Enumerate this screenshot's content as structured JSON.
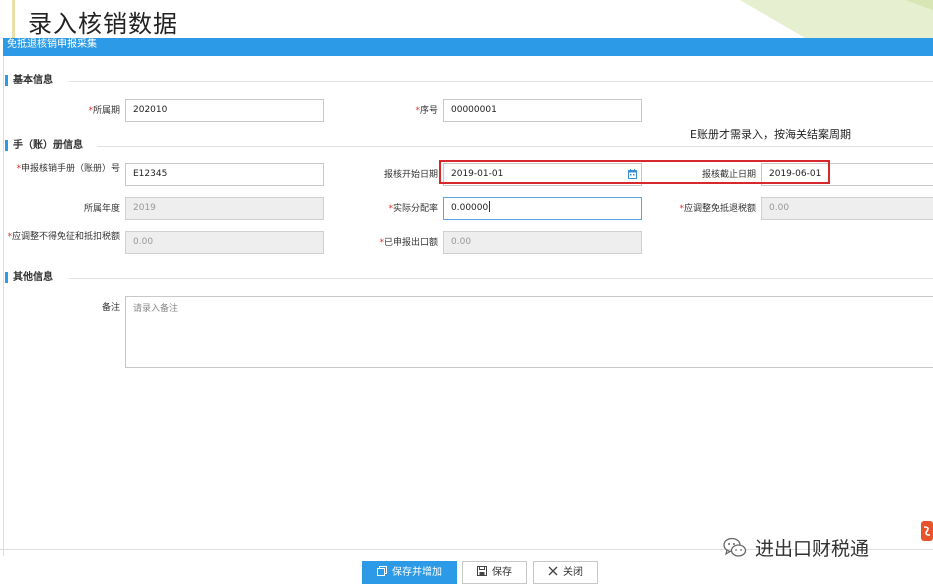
{
  "slide": {
    "title": "录入核销数据"
  },
  "header": {
    "title": "免抵退核销申报采集"
  },
  "sections": {
    "basic": "基本信息",
    "manual": "手（账）册信息",
    "other": "其他信息"
  },
  "fields": {
    "period": {
      "label": "所属期",
      "value": "202010"
    },
    "serial": {
      "label": "序号",
      "value": "00000001"
    },
    "manual_no": {
      "label": "申报核销手册（账册）号",
      "value": "E12345"
    },
    "start_date": {
      "label": "报核开始日期",
      "value": "2019-01-01"
    },
    "end_date": {
      "label": "报核截止日期",
      "value": "2019-06-01"
    },
    "year": {
      "label": "所属年度",
      "value": "2019"
    },
    "ratio": {
      "label": "实际分配率",
      "value": "0.00000"
    },
    "adj_refund": {
      "label": "应调整免抵退税额",
      "value": "0.00"
    },
    "adj_nodeduct": {
      "label": "应调整不得免征和抵扣税额",
      "value": "0.00"
    },
    "exported": {
      "label": "已申报出口额",
      "value": "0.00"
    },
    "remark": {
      "label": "备注",
      "placeholder": "请录入备注"
    }
  },
  "annotation": {
    "note": "E账册才需录入，按海关结案周期"
  },
  "buttons": {
    "save_add": "保存并增加",
    "save": "保存",
    "close": "关闭"
  },
  "watermark": {
    "text": "进出口财税通"
  },
  "colors": {
    "accent": "#2c9ae6",
    "required": "#e0312b",
    "highlight": "#d9272e"
  }
}
